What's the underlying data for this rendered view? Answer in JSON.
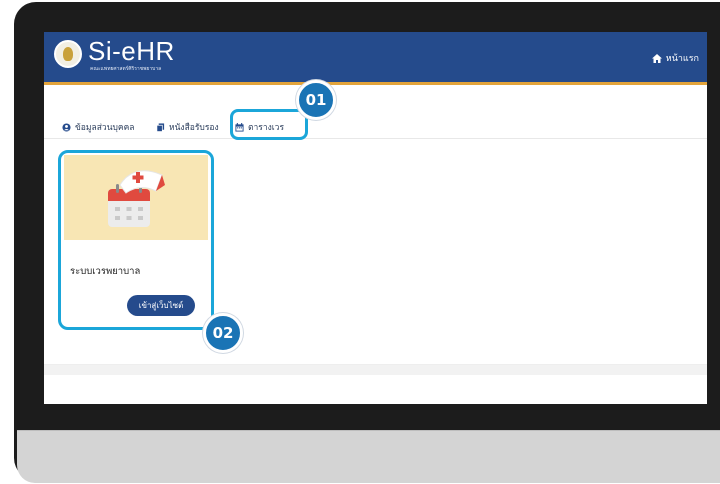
{
  "app": {
    "logo_text": "Si-eHR",
    "logo_subtitle": "คณะแพทยศาสตร์ศิริราชพยาบาล",
    "home_label": "หน้าแรก"
  },
  "tabs": [
    {
      "label": "ข้อมูลส่วนบุคคล",
      "icon": "user-circle-icon"
    },
    {
      "label": "หนังสือรับรอง",
      "icon": "copy-icon"
    },
    {
      "label": "ตารางเวร",
      "icon": "calendar-icon"
    }
  ],
  "card": {
    "title": "ระบบเวรพยาบาล",
    "button_label": "เข้าสู่เว็บไซต์",
    "image": "nurse-cap-calendar-icon"
  },
  "callouts": {
    "step1": "01",
    "step2": "02"
  },
  "colors": {
    "header": "#254b8c",
    "header_border": "#e3a43b",
    "highlight": "#1ba6d9",
    "badge": "#1a74b5",
    "card_image_bg": "#f8e6b4"
  }
}
